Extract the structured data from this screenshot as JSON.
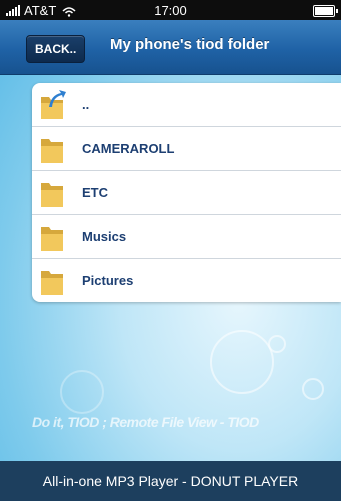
{
  "status_bar": {
    "carrier": "AT&T",
    "time": "17:00"
  },
  "nav": {
    "back_label": "BACK..",
    "title": "My phone's tiod folder"
  },
  "folders": [
    {
      "label": "..",
      "icon": "folder-up-icon"
    },
    {
      "label": "CAMERAROLL",
      "icon": "folder-icon"
    },
    {
      "label": "ETC",
      "icon": "folder-icon"
    },
    {
      "label": "Musics",
      "icon": "folder-icon"
    },
    {
      "label": "Pictures",
      "icon": "folder-icon"
    }
  ],
  "watermark": "Do it, TIOD ; Remote File View - TIOD",
  "banner": "All-in-one MP3 Player - DONUT PLAYER",
  "colors": {
    "nav": "#1f62a6",
    "label": "#1d3f72",
    "banner": "#1d3f5e"
  }
}
